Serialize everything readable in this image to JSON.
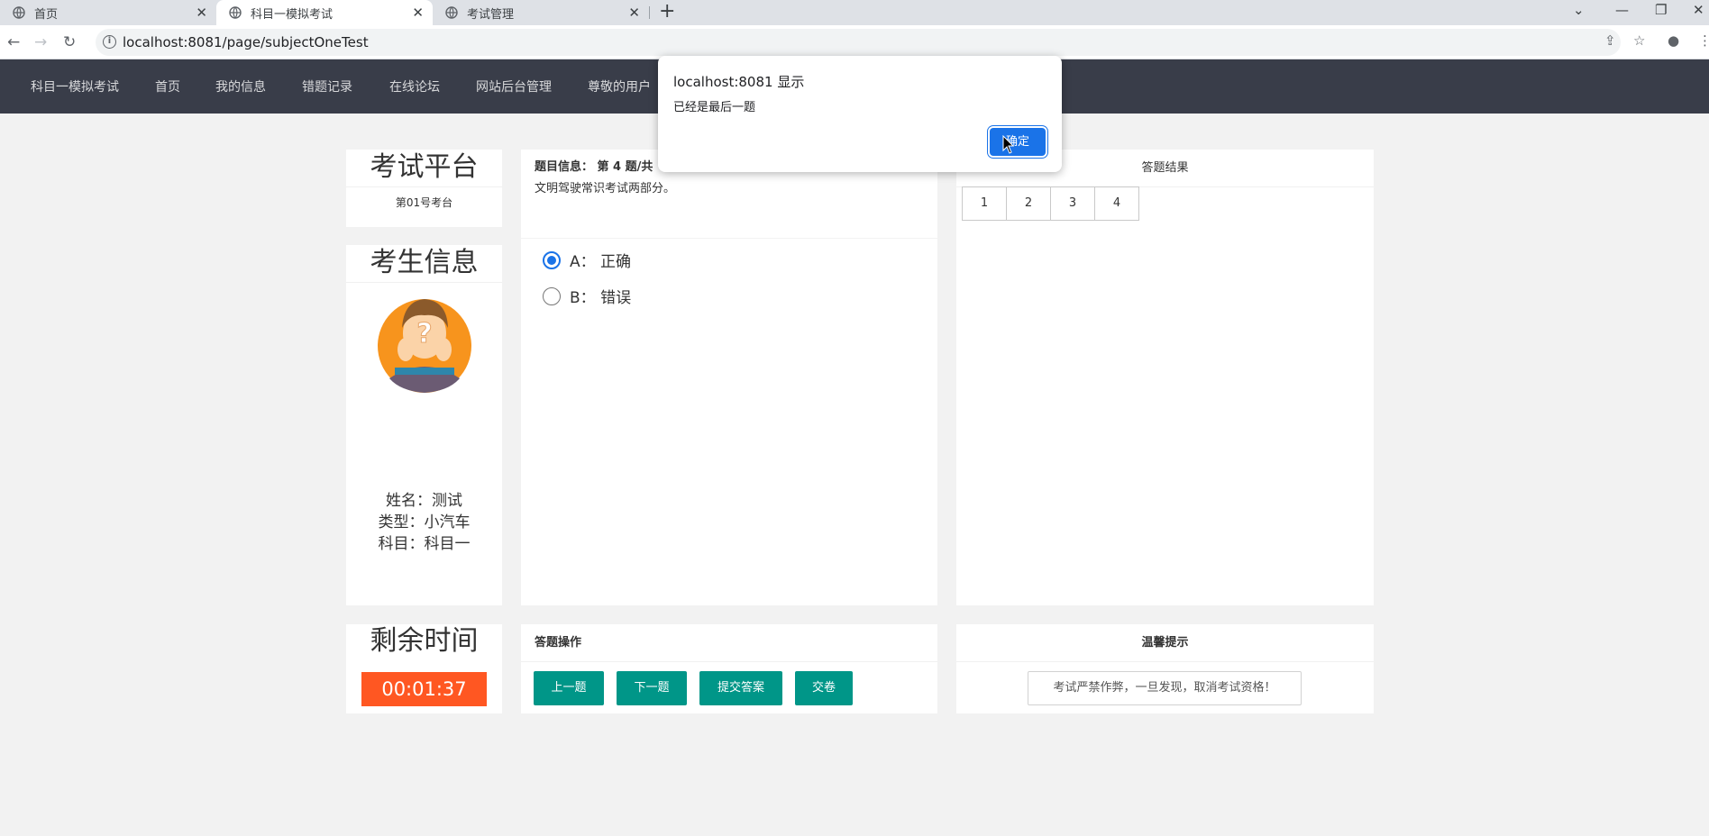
{
  "browser": {
    "tabs": [
      {
        "label": "首页",
        "active": false
      },
      {
        "label": "科目一模拟考试",
        "active": true
      },
      {
        "label": "考试管理",
        "active": false
      }
    ],
    "url": "localhost:8081/page/subjectOneTest"
  },
  "site_nav": {
    "items": [
      "科目一模拟考试",
      "首页",
      "我的信息",
      "错题记录",
      "在线论坛",
      "网站后台管理",
      "尊敬的用户"
    ]
  },
  "platform": {
    "title": "考试平台",
    "subtitle": "第01号考台"
  },
  "student": {
    "title": "考生信息",
    "name": "姓名：测试",
    "type": "类型：小汽车",
    "subject": "科目：科目一"
  },
  "timer": {
    "title": "剩余时间",
    "value": "00:01:37"
  },
  "question": {
    "header": "题目信息： 第 4 题/共",
    "text": "文明驾驶常识考试两部分。",
    "options": [
      {
        "label": "A： 正确",
        "checked": true
      },
      {
        "label": "B： 错误",
        "checked": false
      }
    ]
  },
  "results": {
    "title": "答题结果",
    "cells": [
      "1",
      "2",
      "3",
      "4"
    ]
  },
  "operations": {
    "title": "答题操作",
    "prev_label": "上一题",
    "next_label": "下一题",
    "submit_label": "提交答案",
    "finish_label": "交卷"
  },
  "tips": {
    "title": "温馨提示",
    "text": "考试严禁作弊，一旦发现，取消考试资格！"
  },
  "dialog": {
    "title": "localhost:8081 显示",
    "message": "已经是最后一题",
    "ok_label": "确定"
  },
  "colors": {
    "nav_bg": "#393d49",
    "primary_button": "#009688",
    "timer_bg": "#ff5722",
    "dialog_button": "#1a73e8"
  }
}
